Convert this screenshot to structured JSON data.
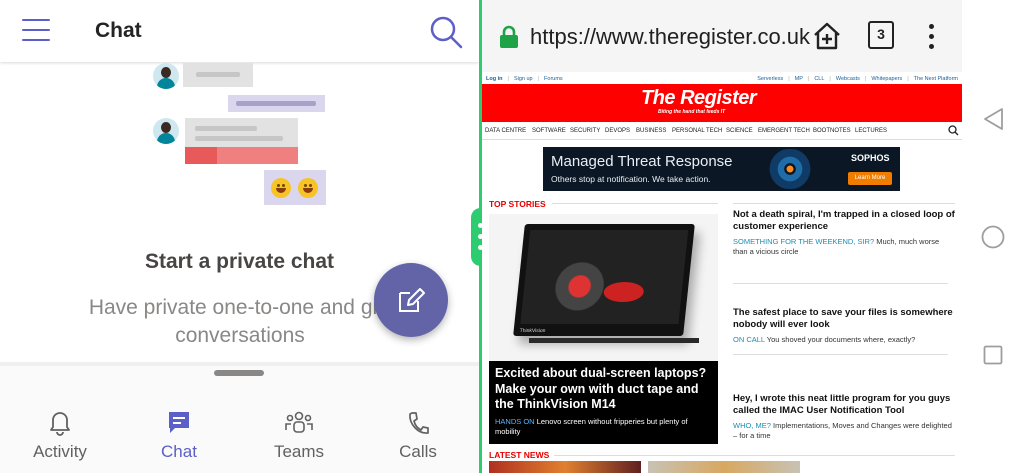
{
  "teams": {
    "header": {
      "title": "Chat"
    },
    "empty_state": {
      "title": "Start a private chat",
      "subtitle_line1": "Have private one-to-one and gro",
      "subtitle_line2": "conversations"
    },
    "bottom_nav": [
      {
        "label": "Activity",
        "icon": "bell-icon",
        "active": false
      },
      {
        "label": "Chat",
        "icon": "chat-icon",
        "active": true
      },
      {
        "label": "Teams",
        "icon": "teams-icon",
        "active": false
      },
      {
        "label": "Calls",
        "icon": "phone-icon",
        "active": false
      }
    ],
    "accent": "#5b5fc7"
  },
  "browser": {
    "url_scheme": "https://",
    "url_host": "www.theregister.co.uk",
    "tab_count": "3",
    "site": {
      "top_links_left": [
        "Log in",
        "Sign up",
        "Forums"
      ],
      "top_links_right": [
        "Serverless",
        "MP",
        "CLL",
        "Webcasts",
        "Whitepapers",
        "The Next Platform"
      ],
      "logo": "The Register",
      "tagline": "Biting the hand that feeds IT",
      "sections": [
        "DATA CENTRE",
        "SOFTWARE",
        "SECURITY",
        "DEVOPS",
        "BUSINESS",
        "PERSONAL TECH",
        "SCIENCE",
        "EMERGENT TECH",
        "BOOTNOTES",
        "LECTURES"
      ],
      "ad": {
        "headline": "Managed Threat Response",
        "subline": "Others stop at notification. We take action.",
        "brand": "SOPHOS",
        "button": "Learn More"
      },
      "top_stories_label": "TOP STORIES",
      "hero": {
        "headline": "Excited about dual-screen laptops? Make your own with duct tape and the ThinkVision M14",
        "kicker": "HANDS ON",
        "standfirst": "Lenovo screen without fripperies but plenty of mobility",
        "image_brand": "ThinkVision"
      },
      "stories": [
        {
          "headline": "Not a death spiral, I'm trapped in a closed loop of customer experience",
          "kicker": "SOMETHING FOR THE WEEKEND, SIR?",
          "standfirst": "Much, much worse than a vicious circle"
        },
        {
          "headline": "The safest place to save your files is somewhere nobody will ever look",
          "kicker": "ON CALL",
          "standfirst": "You shoved your documents where, exactly?"
        },
        {
          "headline": "Hey, I wrote this neat little program for you guys called the IMAC User Notification Tool",
          "kicker": "WHO, ME?",
          "standfirst": "Implementations, Moves and Changes were delighted – for a time"
        }
      ],
      "latest_news_label": "LATEST NEWS"
    }
  },
  "splitter_color": "#2ecc71",
  "brand_red": "#ff0000"
}
